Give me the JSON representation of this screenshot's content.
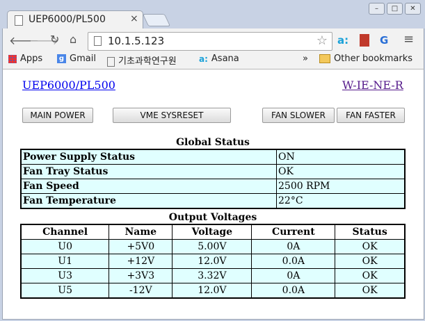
{
  "browser": {
    "tab_title": "UEP6000/PL500",
    "tab_close": "×",
    "url": "10.1.5.123",
    "window_buttons": {
      "minimize": "–",
      "maximize": "□",
      "close": "✕"
    }
  },
  "bookmarks": [
    {
      "label": "Apps",
      "icon": "apps-grid-icon"
    },
    {
      "label": "Gmail",
      "icon": "google-g-icon"
    },
    {
      "label": "기초과학연구원",
      "icon": "page-icon"
    },
    {
      "label": "Asana",
      "icon": "asana-icon"
    }
  ],
  "bookmarks_overflow": "»",
  "other_bookmarks": "Other bookmarks",
  "page": {
    "left_link": "UEP6000/PL500",
    "right_link": "W-IE-NE-R",
    "buttons": {
      "main_power": "MAIN POWER",
      "sysreset": "VME SYSRESET",
      "fan_slower": "FAN SLOWER",
      "fan_faster": "FAN FASTER"
    },
    "global_status": {
      "title": "Global Status",
      "rows": [
        {
          "label": "Power Supply Status",
          "value": "ON"
        },
        {
          "label": "Fan Tray Status",
          "value": "OK"
        },
        {
          "label": "Fan Speed",
          "value": "2500 RPM"
        },
        {
          "label": "Fan Temperature",
          "value": "22°C"
        }
      ]
    },
    "output_voltages": {
      "title": "Output Voltages",
      "headers": [
        "Channel",
        "Name",
        "Voltage",
        "Current",
        "Status"
      ],
      "rows": [
        [
          "U0",
          "+5V0",
          "5.00V",
          "0A",
          "OK"
        ],
        [
          "U1",
          "+12V",
          "12.0V",
          "0.0A",
          "OK"
        ],
        [
          "U3",
          "+3V3",
          "3.32V",
          "0A",
          "OK"
        ],
        [
          "U5",
          "-12V",
          "12.0V",
          "0.0A",
          "OK"
        ]
      ]
    }
  },
  "colors": {
    "link": "#0000ee",
    "visited_link": "#551a8b",
    "cell_bg": "#e0ffff"
  }
}
